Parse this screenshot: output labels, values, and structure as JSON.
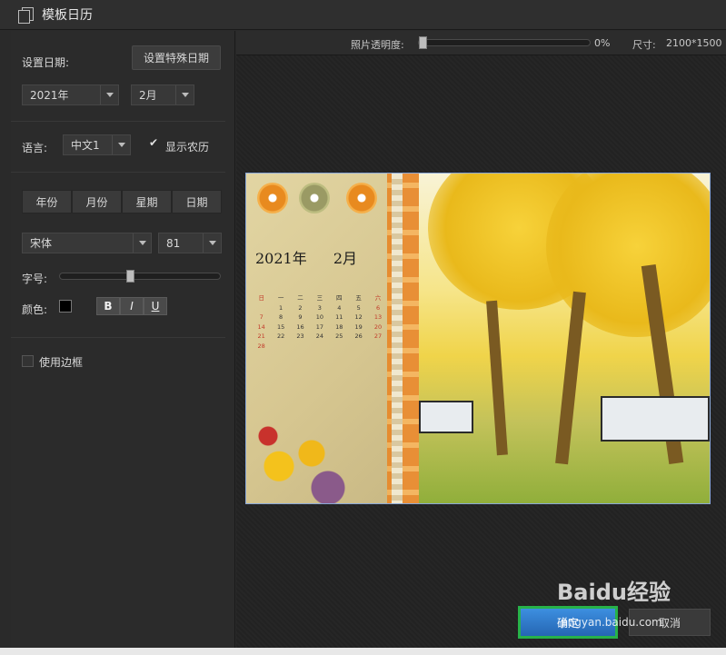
{
  "window": {
    "title": "模板日历"
  },
  "left": {
    "set_date_label": "设置日期:",
    "special_date_button": "设置特殊日期",
    "year_select": "2021年",
    "month_select": "2月",
    "language_label": "语言:",
    "language_select": "中文1",
    "show_lunar_label": "显示农历",
    "show_lunar_checked": true,
    "tabs": [
      "年份",
      "月份",
      "星期",
      "日期"
    ],
    "font_select": "宋体",
    "font_size_select": "81",
    "font_size_label": "字号:",
    "font_size_slider_fraction": 0.43,
    "color_label": "颜色:",
    "text_color": "#000000",
    "bold_label": "B",
    "italic_label": "I",
    "underline_label": "U",
    "use_border_label": "使用边框",
    "use_border_checked": false
  },
  "topbar": {
    "opacity_label": "照片透明度:",
    "opacity_value": "0%",
    "size_label": "尺寸:",
    "size_value": "2100*1500"
  },
  "preview": {
    "year_text": "2021年",
    "month_text": "2月",
    "weekday_headers": [
      "日",
      "一",
      "二",
      "三",
      "四",
      "五",
      "六"
    ],
    "weeks": [
      [
        "",
        "1",
        "2",
        "3",
        "4",
        "5",
        "6"
      ],
      [
        "7",
        "8",
        "9",
        "10",
        "11",
        "12",
        "13"
      ],
      [
        "14",
        "15",
        "16",
        "17",
        "18",
        "19",
        "20"
      ],
      [
        "21",
        "22",
        "23",
        "24",
        "25",
        "26",
        "27"
      ],
      [
        "28",
        "",
        "",
        "",
        "",
        "",
        ""
      ]
    ]
  },
  "footer": {
    "ok_label": "确定",
    "cancel_label": "取消"
  },
  "watermark": {
    "brand": "Baidu经验",
    "url": "jingyan.baidu.com"
  }
}
